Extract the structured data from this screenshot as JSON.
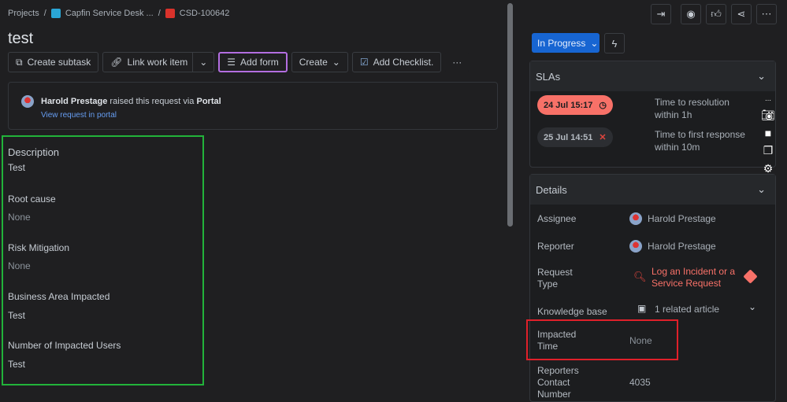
{
  "breadcrumb": {
    "projects": "Projects",
    "project": "Capfin Service Desk ...",
    "issue": "CSD-100642",
    "sep": "/"
  },
  "title": "test",
  "toolbar": {
    "create_subtask": "Create subtask",
    "link_work_item": "Link work item",
    "add_form": "Add form",
    "create": "Create",
    "add_checklist": "Add Checklist.",
    "more": "···"
  },
  "request": {
    "user": "Harold Prestage",
    "middle": " raised this request via ",
    "channel": "Portal",
    "link": "View request in portal"
  },
  "fields": [
    {
      "label": "Description",
      "value": "Test"
    },
    {
      "label": "Root cause",
      "value": "None"
    },
    {
      "label": "Risk Mitigation",
      "value": "None"
    },
    {
      "label": "Business Area Impacted",
      "value": "Test"
    },
    {
      "label": "Number of Impacted Users",
      "value": "Test"
    }
  ],
  "status": "In Progress",
  "slas": {
    "title": "SLAs",
    "items": [
      {
        "time": "24 Jul 15:17",
        "label": "Time to resolution",
        "sub": "within 1h",
        "color": "#f87168"
      },
      {
        "time": "25 Jul 14:51",
        "label": "Time to first response",
        "sub": "within 10m"
      }
    ]
  },
  "details": {
    "title": "Details",
    "assignee_label": "Assignee",
    "assignee": "Harold Prestage",
    "reporter_label": "Reporter",
    "reporter": "Harold Prestage",
    "request_type_label_1": "Request",
    "request_type_label_2": "Type",
    "request_type_1": "Log an Incident or a",
    "request_type_2": "Service Request",
    "kb_label": "Knowledge base",
    "kb": "1 related article",
    "impacted_label_1": "Impacted",
    "impacted_label_2": "Time",
    "impacted": "None",
    "contact_label_1": "Reporters",
    "contact_label_2": "Contact",
    "contact_label_3": "Number",
    "contact": "4035"
  }
}
